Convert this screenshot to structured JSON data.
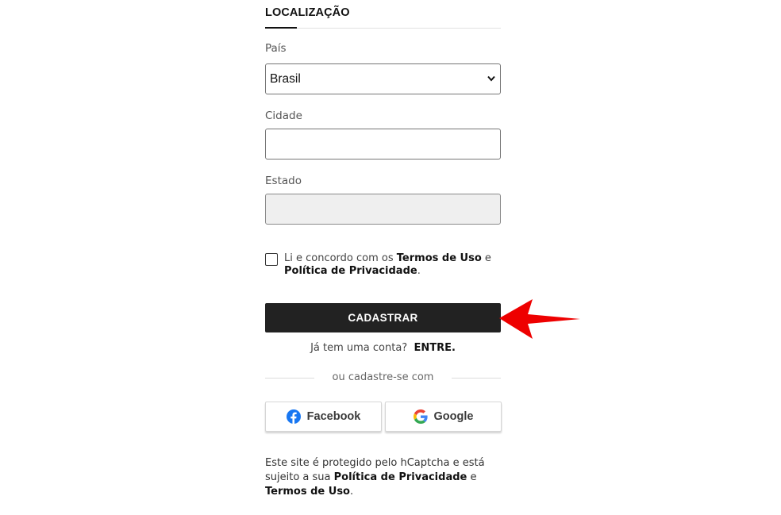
{
  "location_section": {
    "title": "LOCALIZAÇÃO"
  },
  "fields": {
    "country_label": "País",
    "country_value": "Brasil",
    "city_label": "Cidade",
    "city_value": "",
    "state_label": "Estado",
    "state_value": ""
  },
  "consent": {
    "prefix": "Li e concordo com os ",
    "terms": "Termos de Uso",
    "middle": " e ",
    "privacy": "Política de Privacidade",
    "suffix": "."
  },
  "submit": {
    "label": "CADASTRAR"
  },
  "login_prompt": {
    "text": "Já tem uma conta?",
    "link": "ENTRE."
  },
  "social": {
    "divider_text": "ou cadastre-se com",
    "facebook_label": "Facebook",
    "google_label": "Google"
  },
  "legal": {
    "line1": "Este site é protegido pelo hCaptcha e está sujeito a sua ",
    "privacy": "Política de Privacidade",
    "middle": " e ",
    "terms": "Termos de Uso",
    "suffix": "."
  },
  "colors": {
    "button_bg": "#222222",
    "annotation_arrow": "#ee0000",
    "facebook_blue": "#1877f2"
  },
  "icons": {
    "facebook": "facebook-icon",
    "google": "google-icon",
    "select": "chevron-down-icon",
    "annotation": "red-arrow-icon"
  }
}
